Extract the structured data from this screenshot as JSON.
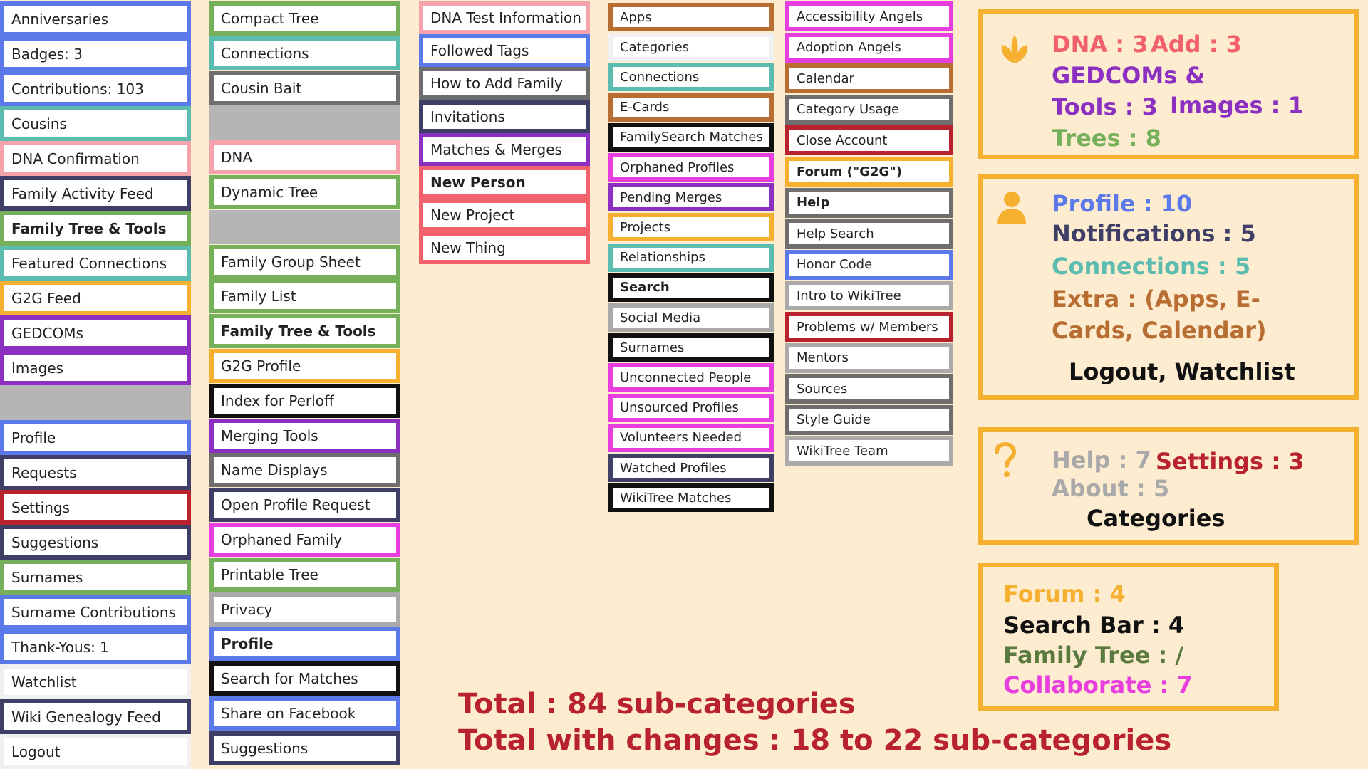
{
  "columns": [
    {
      "items": [
        {
          "label": "Anniversaries",
          "color": "#5b79e8"
        },
        {
          "label": "Badges: 3",
          "color": "#5b79e8"
        },
        {
          "label": "Contributions: 103",
          "color": "#5b79e8"
        },
        {
          "label": "Cousins",
          "color": "#5cbcb0"
        },
        {
          "label": "DNA Confirmation",
          "color": "#f5a3ab"
        },
        {
          "label": "Family Activity Feed",
          "color": "#3e3e66"
        },
        {
          "label": "Family Tree & Tools",
          "color": "#76b05a",
          "bold": true
        },
        {
          "label": "Featured Connections",
          "color": "#5cbcb0"
        },
        {
          "label": "G2G Feed",
          "color": "#f5b02f"
        },
        {
          "label": "GEDCOMs",
          "color": "#8b30c0"
        },
        {
          "label": "Images",
          "color": "#8b30c0"
        },
        {
          "label": "",
          "gray": true
        },
        {
          "label": "Profile",
          "color": "#5b79e8"
        },
        {
          "label": "Requests",
          "color": "#3e3e66"
        },
        {
          "label": "Settings",
          "color": "#b8222c"
        },
        {
          "label": "Suggestions",
          "color": "#3e3e66"
        },
        {
          "label": "Surnames",
          "color": "#76b05a"
        },
        {
          "label": "Surname Contributions",
          "color": "#5b79e8"
        },
        {
          "label": "Thank-Yous: 1",
          "color": "#5b79e8"
        },
        {
          "label": "Watchlist",
          "color": "#ffffff"
        },
        {
          "label": "Wiki Genealogy Feed",
          "color": "#3e3e66"
        },
        {
          "label": "Logout",
          "color": "#ffffff"
        }
      ]
    },
    {
      "items": [
        {
          "label": "Compact Tree",
          "color": "#76b05a"
        },
        {
          "label": "Connections",
          "color": "#5cbcb0"
        },
        {
          "label": "Cousin Bait",
          "color": "#6e6e6e"
        },
        {
          "label": "",
          "gray": true
        },
        {
          "label": "DNA",
          "color": "#f5a3ab"
        },
        {
          "label": "Dynamic Tree",
          "color": "#76b05a"
        },
        {
          "label": "",
          "gray": true
        },
        {
          "label": "Family Group Sheet",
          "color": "#76b05a"
        },
        {
          "label": "Family List",
          "color": "#76b05a"
        },
        {
          "label": "Family Tree & Tools",
          "color": "#76b05a",
          "bold": true
        },
        {
          "label": "G2G Profile",
          "color": "#f5b02f"
        },
        {
          "label": "Index for Perloff",
          "color": "#111111"
        },
        {
          "label": "Merging Tools",
          "color": "#8b30c0"
        },
        {
          "label": "Name Displays",
          "color": "#6e6e6e"
        },
        {
          "label": "Open Profile Request",
          "color": "#3e3e66"
        },
        {
          "label": "Orphaned Family",
          "color": "#e83ee0"
        },
        {
          "label": "Printable Tree",
          "color": "#76b05a"
        },
        {
          "label": "Privacy",
          "color": "#aaaaaa"
        },
        {
          "label": "Profile",
          "color": "#5b79e8",
          "bold": true
        },
        {
          "label": "Search for Matches",
          "color": "#111111"
        },
        {
          "label": "Share on Facebook",
          "color": "#5b79e8"
        },
        {
          "label": "Suggestions",
          "color": "#3e3e66"
        }
      ]
    },
    {
      "items": [
        {
          "label": "DNA Test Information",
          "color": "#f5a3ab"
        },
        {
          "label": "Followed Tags",
          "color": "#5b79e8"
        },
        {
          "label": "How to Add Family",
          "color": "#6e6e6e"
        },
        {
          "label": "Invitations",
          "color": "#3e3e66"
        },
        {
          "label": "Matches & Merges",
          "color": "#8b30c0"
        },
        {
          "label": "New Person",
          "color": "#f0616b",
          "bold": true
        },
        {
          "label": "New Project",
          "color": "#f0616b"
        },
        {
          "label": "New Thing",
          "color": "#f0616b"
        }
      ]
    },
    {
      "items": [
        {
          "label": "Apps",
          "color": "#b86e32"
        },
        {
          "label": "Categories",
          "color": "#ffffff"
        },
        {
          "label": "Connections",
          "color": "#5cbcb0"
        },
        {
          "label": "E-Cards",
          "color": "#b86e32"
        },
        {
          "label": "FamilySearch Matches",
          "color": "#111111"
        },
        {
          "label": "Orphaned Profiles",
          "color": "#e83ee0"
        },
        {
          "label": "Pending Merges",
          "color": "#8b30c0"
        },
        {
          "label": "Projects",
          "color": "#f5b02f"
        },
        {
          "label": "Relationships",
          "color": "#5cbcb0"
        },
        {
          "label": "Search",
          "color": "#111111",
          "bold": true
        },
        {
          "label": "Social Media",
          "color": "#aaaaaa"
        },
        {
          "label": "Surnames",
          "color": "#111111"
        },
        {
          "label": "Unconnected People",
          "color": "#e83ee0"
        },
        {
          "label": "Unsourced Profiles",
          "color": "#e83ee0"
        },
        {
          "label": "Volunteers Needed",
          "color": "#e83ee0"
        },
        {
          "label": "Watched Profiles",
          "color": "#3e3e66"
        },
        {
          "label": "WikiTree Matches",
          "color": "#111111"
        }
      ]
    },
    {
      "items": [
        {
          "label": "Accessibility Angels",
          "color": "#e83ee0"
        },
        {
          "label": "Adoption Angels",
          "color": "#e83ee0"
        },
        {
          "label": "Calendar",
          "color": "#b86e32"
        },
        {
          "label": "Category Usage",
          "color": "#6e6e6e"
        },
        {
          "label": "Close Account",
          "color": "#b8222c"
        },
        {
          "label": "Forum (\"G2G\")",
          "color": "#f5b02f",
          "bold": true
        },
        {
          "label": "Help",
          "color": "#6e6e6e",
          "bold": true
        },
        {
          "label": "Help Search",
          "color": "#6e6e6e"
        },
        {
          "label": "Honor Code",
          "color": "#5b79e8"
        },
        {
          "label": "Intro to WikiTree",
          "color": "#aaaaaa"
        },
        {
          "label": "Problems w/ Members",
          "color": "#b8222c"
        },
        {
          "label": "Mentors",
          "color": "#aaaaaa"
        },
        {
          "label": "Sources",
          "color": "#6e6e6e"
        },
        {
          "label": "Style Guide",
          "color": "#6e6e6e"
        },
        {
          "label": "WikiTree Team",
          "color": "#aaaaaa"
        }
      ]
    }
  ],
  "stats": {
    "tree": {
      "icon": "sprout-icon",
      "dna": "DNA : 3",
      "add": "Add : 3",
      "gedcoms_line1": "GEDCOMs &",
      "gedcoms_line2": "Tools : 3",
      "images": "Images : 1",
      "trees": "Trees : 8"
    },
    "profile": {
      "icon": "person-icon",
      "profile": "Profile : 10",
      "notifications": "Notifications : 5",
      "connections": "Connections : 5",
      "extra_line1": "Extra : (Apps, E-",
      "extra_line2": "Cards, Calendar)",
      "logout": "Logout, Watchlist"
    },
    "help": {
      "icon": "question-icon",
      "help": "Help : 7",
      "settings": "Settings : 3",
      "about": "About : 5",
      "categories": "Categories"
    },
    "forum": {
      "forum": "Forum : 4",
      "search": "Search Bar : 4",
      "family": "Family Tree : /",
      "collab": "Collaborate : 7"
    }
  },
  "totals": {
    "total": "Total : 84 sub-categories",
    "changes": "Total with changes : 18 to 22 sub-categories"
  },
  "colors": {
    "background": "#fdecd0",
    "frame": "#f5b02f",
    "total": "#b8222c",
    "pink": "#f0616b",
    "purple": "#8b30c0",
    "green": "#76b05a",
    "blue": "#5b79e8",
    "navy": "#3e3e66",
    "teal": "#5cbcb0",
    "brown": "#b86e32",
    "gray": "#a9a9a9",
    "magenta": "#e83ee0",
    "olive": "#5b7a3f"
  }
}
